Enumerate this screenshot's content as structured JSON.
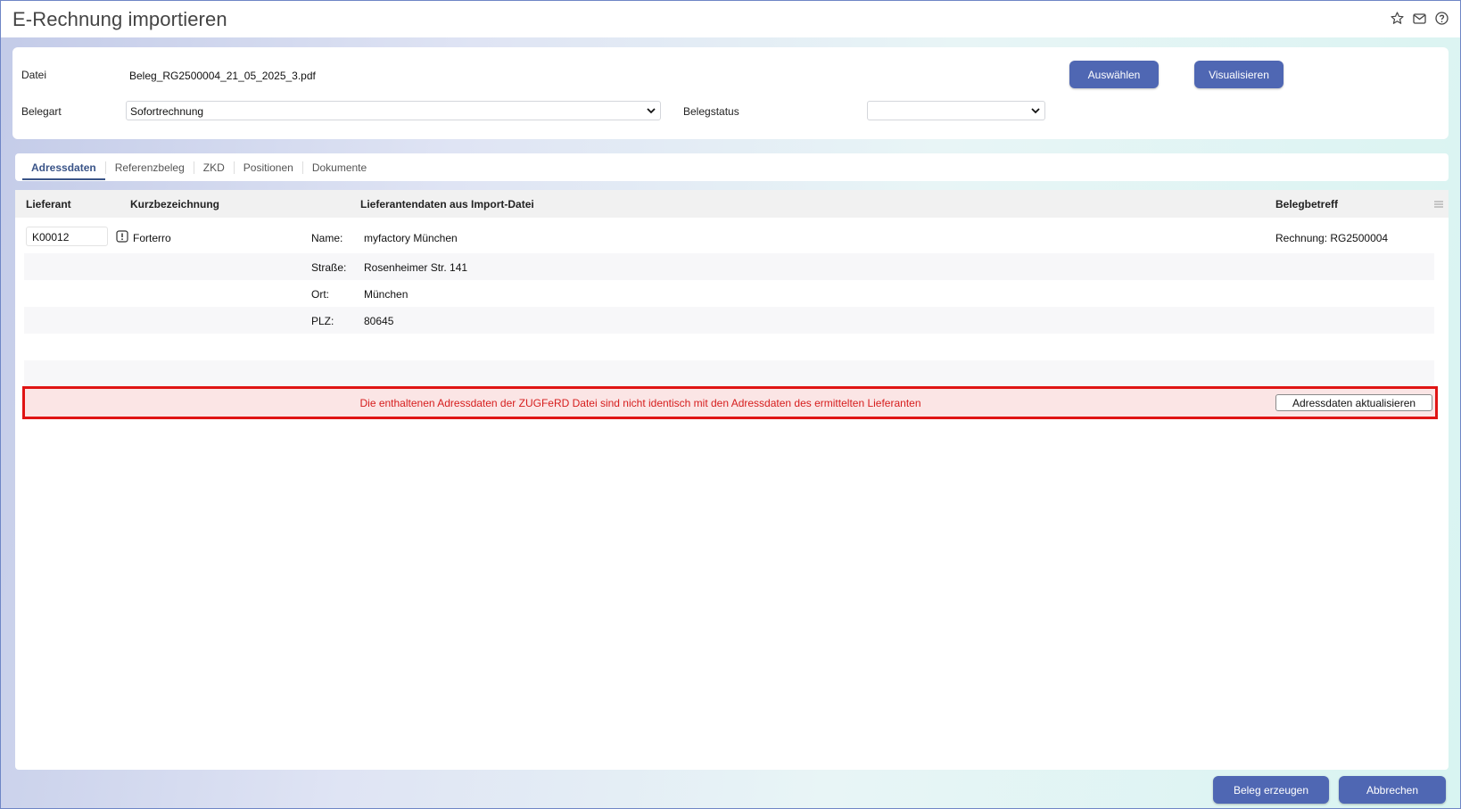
{
  "window": {
    "title": "E-Rechnung importieren",
    "icons": [
      "star-icon",
      "mail-icon",
      "help-icon"
    ]
  },
  "form": {
    "datei_label": "Datei",
    "datei_value": "Beleg_RG2500004_21_05_2025_3.pdf",
    "belegart_label": "Belegart",
    "belegart_value": "Sofortrechnung",
    "belegstatus_label": "Belegstatus",
    "belegstatus_value": "",
    "auswaehlen_label": "Auswählen",
    "visualisieren_label": "Visualisieren"
  },
  "tabs": [
    {
      "label": "Adressdaten",
      "active": true
    },
    {
      "label": "Referenzbeleg",
      "active": false
    },
    {
      "label": "ZKD",
      "active": false
    },
    {
      "label": "Positionen",
      "active": false
    },
    {
      "label": "Dokumente",
      "active": false
    }
  ],
  "table": {
    "headers": {
      "lieferant": "Lieferant",
      "kurz": "Kurzbezeichnung",
      "import": "Lieferantendaten aus Import-Datei",
      "betreff": "Belegbetreff"
    },
    "lieferant_id": "K00012",
    "kurzbezeichnung": "Forterro",
    "betreff": "Rechnung: RG2500004",
    "import_rows": [
      {
        "label": "Name:",
        "value": "myfactory München"
      },
      {
        "label": "Straße:",
        "value": "Rosenheimer Str. 141"
      },
      {
        "label": "Ort:",
        "value": "München"
      },
      {
        "label": "PLZ:",
        "value": "80645"
      }
    ]
  },
  "warning": {
    "text": "Die enthaltenen Adressdaten der ZUGFeRD Datei sind nicht identisch mit den Adressdaten des ermittelten Lieferanten",
    "button_label": "Adressdaten aktualisieren"
  },
  "footer": {
    "create_label": "Beleg erzeugen",
    "cancel_label": "Abbrechen"
  },
  "colors": {
    "primary": "#4f67b3",
    "warning_border": "#e01414",
    "warning_text": "#d61d1d",
    "warning_bg": "#fbe5e5"
  }
}
